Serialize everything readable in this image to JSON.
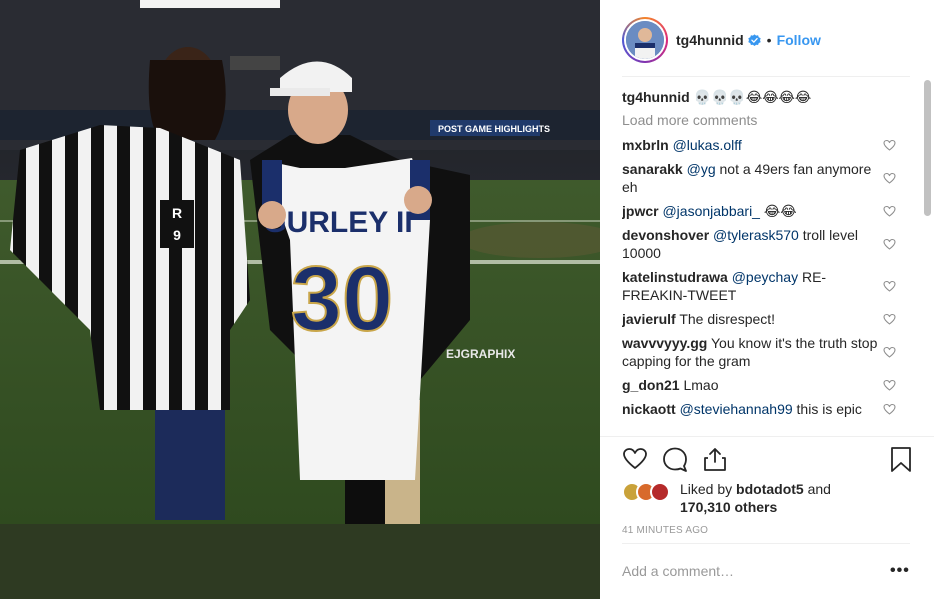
{
  "post": {
    "photo_watermark": "EJGRAPHIX",
    "jersey_name": "GURLEY II",
    "jersey_number": "30",
    "ref_patch_letter": "R",
    "ref_patch_number": "9",
    "stadium_banner": "POST GAME HIGHLIGHTS"
  },
  "header": {
    "username": "tg4hunnid",
    "separator": "•",
    "follow_label": "Follow",
    "verified_icon": "verified-badge-icon"
  },
  "caption": {
    "user": "tg4hunnid",
    "text": "💀💀💀😂😂😂😂"
  },
  "load_more_label": "Load more comments",
  "comments": [
    {
      "user": "mxbrln",
      "mention": "@lukas.olff",
      "text": ""
    },
    {
      "user": "sanarakk",
      "mention": "@yg",
      "text": " not a 49ers fan anymore eh"
    },
    {
      "user": "jpwcr",
      "mention": "@jasonjabbari_",
      "text": " 😂😂"
    },
    {
      "user": "devonshover",
      "mention": "@tylerask570",
      "text": " troll level 10000"
    },
    {
      "user": "katelinstudrawa",
      "mention": "@peychay",
      "text": " RE-FREAKIN-TWEET"
    },
    {
      "user": "javierulf",
      "mention": "",
      "text": "The disrespect!"
    },
    {
      "user": "wavvvyyy.gg",
      "mention": "",
      "text": "You know it's the truth stop capping for the gram"
    },
    {
      "user": "g_don21",
      "mention": "",
      "text": "Lmao"
    },
    {
      "user": "nickaott",
      "mention": "@steviehannah99",
      "text": " this is epic"
    }
  ],
  "likes": {
    "prefix": "Liked by ",
    "user": "bdotadot5",
    "middle": " and",
    "count": "170,310 others"
  },
  "timestamp": "41 MINUTES AGO",
  "add_comment_placeholder": "Add a comment…",
  "more_label": "•••",
  "colors": {
    "accent": "#3897f0",
    "mention": "#003569",
    "muted": "#8e8e8e",
    "field": "#2e3a22"
  }
}
